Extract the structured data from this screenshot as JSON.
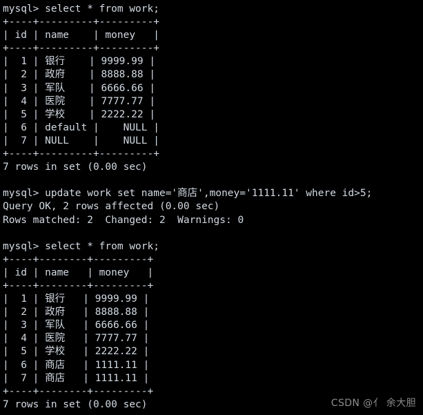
{
  "terminal": {
    "background_color": "#000000",
    "foreground_color": "#d3dae3",
    "prompt": "mysql>",
    "lines": [
      "mysql> select * from work;",
      "+----+---------+---------+",
      "| id | name    | money   |",
      "+----+---------+---------+",
      "|  1 | 银行    | 9999.99 |",
      "|  2 | 政府    | 8888.88 |",
      "|  3 | 军队    | 6666.66 |",
      "|  4 | 医院    | 7777.77 |",
      "|  5 | 学校    | 2222.22 |",
      "|  6 | default |    NULL |",
      "|  7 | NULL    |    NULL |",
      "+----+---------+---------+",
      "7 rows in set (0.00 sec)",
      "",
      "mysql> update work set name='商店',money='1111.11' where id>5;",
      "Query OK, 2 rows affected (0.00 sec)",
      "Rows matched: 2  Changed: 2  Warnings: 0",
      "",
      "mysql> select * from work;",
      "+----+--------+---------+",
      "| id | name   | money   |",
      "+----+--------+---------+",
      "|  1 | 银行   | 9999.99 |",
      "|  2 | 政府   | 8888.88 |",
      "|  3 | 军队   | 6666.66 |",
      "|  4 | 医院   | 7777.77 |",
      "|  5 | 学校   | 2222.22 |",
      "|  6 | 商店   | 1111.11 |",
      "|  7 | 商店   | 1111.11 |",
      "+----+--------+---------+",
      "7 rows in set (0.00 sec)"
    ]
  },
  "queries": {
    "select_statement": "select * from work;",
    "update_statement": "update work set name='商店',money='1111.11' where id>5;",
    "query_ok": "Query OK, 2 rows affected (0.00 sec)",
    "rows_matched": "Rows matched: 2  Changed: 2  Warnings: 0",
    "rows_in_set": "7 rows in set (0.00 sec)"
  },
  "result_table_before": {
    "columns": [
      "id",
      "name",
      "money"
    ],
    "rows": [
      [
        "1",
        "银行",
        "9999.99"
      ],
      [
        "2",
        "政府",
        "8888.88"
      ],
      [
        "3",
        "军队",
        "6666.66"
      ],
      [
        "4",
        "医院",
        "7777.77"
      ],
      [
        "5",
        "学校",
        "2222.22"
      ],
      [
        "6",
        "default",
        "NULL"
      ],
      [
        "7",
        "NULL",
        "NULL"
      ]
    ],
    "row_count": 7,
    "duration": "0.00 sec"
  },
  "result_table_after": {
    "columns": [
      "id",
      "name",
      "money"
    ],
    "rows": [
      [
        "1",
        "银行",
        "9999.99"
      ],
      [
        "2",
        "政府",
        "8888.88"
      ],
      [
        "3",
        "军队",
        "6666.66"
      ],
      [
        "4",
        "医院",
        "7777.77"
      ],
      [
        "5",
        "学校",
        "2222.22"
      ],
      [
        "6",
        "商店",
        "1111.11"
      ],
      [
        "7",
        "商店",
        "1111.11"
      ]
    ],
    "row_count": 7,
    "duration": "0.00 sec"
  },
  "watermark": {
    "text": "CSDN @亻 余大胆",
    "color": "#8d8d8d"
  }
}
